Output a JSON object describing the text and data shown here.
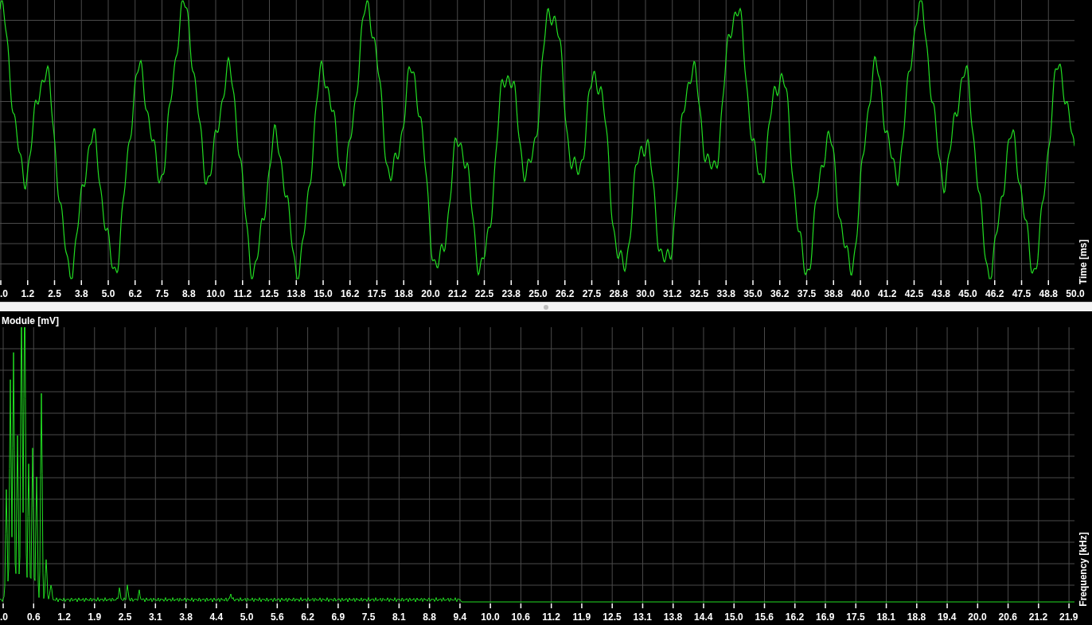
{
  "time_panel": {
    "axis_label": "Time [ms]",
    "x_ticks": [
      ".0",
      "1.2",
      "2.5",
      "3.8",
      "5.0",
      "6.2",
      "7.5",
      "8.8",
      "10.0",
      "11.2",
      "12.5",
      "13.8",
      "15.0",
      "16.2",
      "17.5",
      "18.8",
      "20.0",
      "21.2",
      "22.5",
      "23.8",
      "25.0",
      "26.2",
      "27.5",
      "28.8",
      "30.0",
      "31.2",
      "32.5",
      "33.8",
      "35.0",
      "36.2",
      "37.5",
      "38.8",
      "40.0",
      "41.2",
      "42.5",
      "43.8",
      "45.0",
      "46.2",
      "47.5",
      "48.8",
      "50.0"
    ]
  },
  "spectrum_panel": {
    "axis_label_top": "Module [mV]",
    "axis_label_right": "Frequency [kHz]",
    "x_ticks": [
      ".0",
      "0.6",
      "1.2",
      "1.9",
      "2.5",
      "3.1",
      "3.8",
      "4.4",
      "5.0",
      "5.6",
      "6.2",
      "6.9",
      "7.5",
      "8.1",
      "8.8",
      "9.4",
      "10.0",
      "10.6",
      "11.2",
      "11.9",
      "12.5",
      "13.1",
      "13.8",
      "14.4",
      "15.0",
      "15.6",
      "16.2",
      "16.9",
      "17.5",
      "18.1",
      "18.8",
      "19.4",
      "20.0",
      "20.6",
      "21.2",
      "21.9"
    ]
  }
}
